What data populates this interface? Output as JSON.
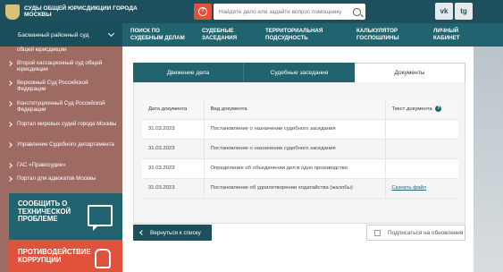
{
  "header": {
    "logo_text": "Суды общей юрисдикции города Москвы",
    "search_placeholder": "Найдите дело или задайте вопрос помощнику",
    "help_icon": "?",
    "social": {
      "vk": "vk",
      "telegram": "tg"
    }
  },
  "nav": {
    "court_select": "Басманный районный суд",
    "items": [
      {
        "label": "Поиск по судебным делам"
      },
      {
        "label": "Судебные заседания"
      },
      {
        "label": "Территориальная подсудность"
      },
      {
        "label": "Калькулятор госпошлины"
      },
      {
        "label": "Личный кабинет"
      }
    ]
  },
  "sidebar": {
    "items": [
      {
        "label": "общей юрисдикции"
      },
      {
        "label": "Второй кассационный суд общей юрисдикции"
      },
      {
        "label": "Верховный Суд Российской Федерации"
      },
      {
        "label": "Конституционный Суд Российской Федерации"
      },
      {
        "label": "Портал мировых судей города Москвы"
      },
      {
        "label": "Управление Судебного департамента"
      },
      {
        "label": "ГАС «Правосудие»"
      },
      {
        "label": "Портал для адвокатов Москвы"
      }
    ],
    "report_box": "Сообщить о технической проблеме",
    "anticorruption": "Противодействие коррупции"
  },
  "tabs": [
    {
      "label": "Движение дела",
      "active": false
    },
    {
      "label": "Судебные заседания",
      "active": false
    },
    {
      "label": "Документы",
      "active": true
    }
  ],
  "documents": {
    "columns": [
      "Дата документа",
      "Вид документа",
      "Текст документа"
    ],
    "rows": [
      {
        "date": "31.03.2023",
        "type": "Постановление о назначении судебного заседания",
        "text": ""
      },
      {
        "date": "31.03.2023",
        "type": "Постановление о назначении судебного заседания",
        "text": ""
      },
      {
        "date": "31.03.2023",
        "type": "Определение об объединении дел в одно производство",
        "text": ""
      },
      {
        "date": "31.03.2023",
        "type": "Постановление об удовлетворении ходатайства (жалобы)",
        "text": "Скачать файл"
      }
    ]
  },
  "actions": {
    "back": "Вернуться к списку",
    "subscribe": "Подписаться на обновления"
  },
  "colors": {
    "header_bg": "#1e4f5c",
    "nav_bg": "#21646f",
    "sidebar_bg": "#9e6b62",
    "alert_red": "#e1523d"
  }
}
